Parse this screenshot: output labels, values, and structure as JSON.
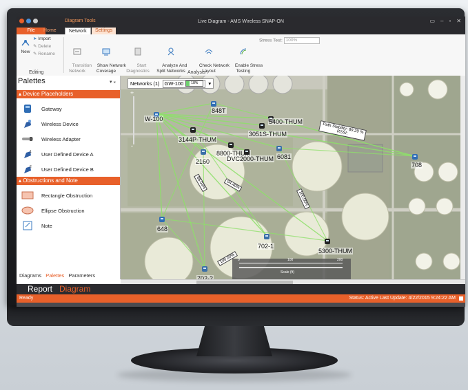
{
  "window": {
    "title": "Live Diagram - AMS Wireless SNAP-ON",
    "context_tab": "Diagram Tools",
    "controls": [
      "▭",
      "–",
      "▫",
      "✕"
    ]
  },
  "tabs": {
    "file": "File",
    "home": "Home",
    "network": "Network",
    "settings": "Settings"
  },
  "ribbon": {
    "import": "Import",
    "new": "New",
    "delete": "Delete",
    "rename": "Rename",
    "editing": "Editing",
    "transition": "Transition\nNetwork",
    "show_coverage": "Show Network\nCoverage",
    "start_diag": "Start\nDiagnostics",
    "analyze": "Analyze And\nSplit Networks",
    "check_layout": "Check Network\nLayout",
    "enable_stress": "Enable Stress\nTesting",
    "analysis": "Analysis",
    "stress_label": "Stress Test:",
    "stress_value": "100%"
  },
  "palettes": {
    "title": "Palettes",
    "pin": "▾  ⁎",
    "section1": "Device Placeholders",
    "items1": [
      "Gateway",
      "Wireless Device",
      "Wireless Adapter",
      "User Defined Device A",
      "User Defined Device B"
    ],
    "section2": "Obstructions and Note",
    "items2": [
      "Rectangle Obstruction",
      "Ellipse Obstruction",
      "Note"
    ],
    "tabs": [
      "Diagrams",
      "Palettes",
      "Parameters"
    ]
  },
  "map": {
    "networks_label": "Networks (1)",
    "network_name": "GW-100",
    "battery": "18%",
    "zoom_plus": "+",
    "zoom_minus": "-",
    "nodes": [
      "W-100",
      "848T",
      "3144P-THUM",
      "3051S-THUM",
      "5400-THUM",
      "8800-THUM",
      "DVC2000-THUM",
      "6081",
      "2160",
      "708",
      "648",
      "702-1",
      "702-2",
      "5300-THUM"
    ],
    "path_note": "Path Stability: 89.29 %\nRSSI:",
    "link_labels": [
      "88.04%",
      "94.40%",
      "100.00%",
      "100.00%"
    ],
    "scale": {
      "t0": "0",
      "t1": "100",
      "t2": "200",
      "label": "Scale (ft)"
    }
  },
  "doctabs": {
    "report": "Report",
    "diagram": "Diagram"
  },
  "status": {
    "left": "Ready",
    "right": "Status: Active  Last Update: 4/22/2015 9:24:22 AM"
  },
  "colors": {
    "accent": "#e8602a",
    "link": "#8ee06a"
  }
}
